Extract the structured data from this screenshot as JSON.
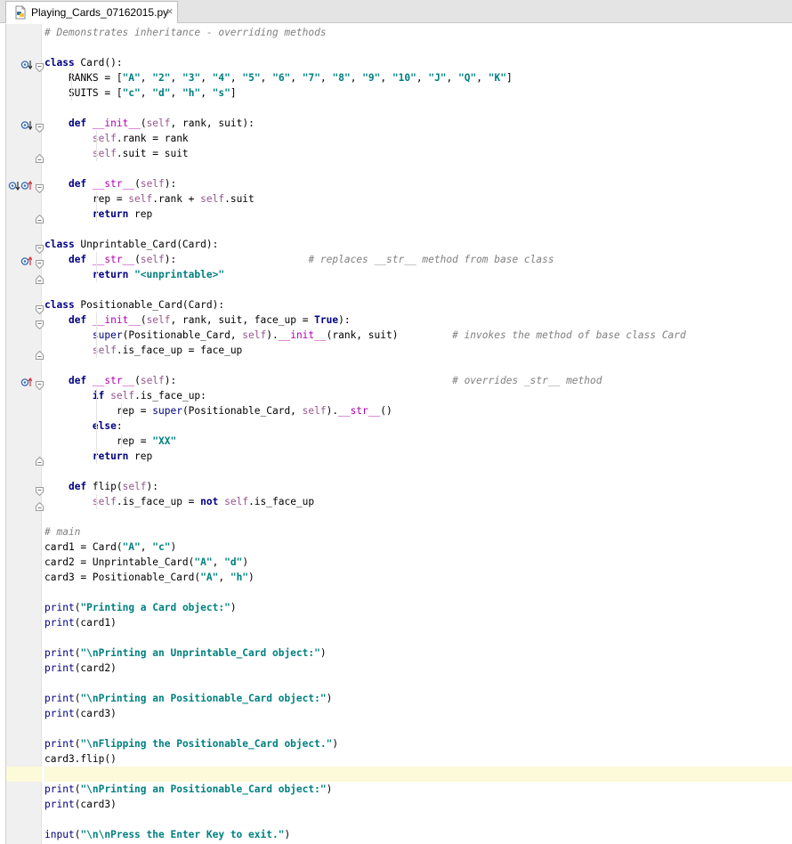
{
  "tab": {
    "title": "Playing_Cards_07162015.py",
    "close": "×"
  },
  "code_lines": [
    "# Demonstrates inheritance - overriding methods",
    "",
    "class Card():",
    "    RANKS = [\"A\", \"2\", \"3\", \"4\", \"5\", \"6\", \"7\", \"8\", \"9\", \"10\", \"J\", \"Q\", \"K\"]",
    "    SUITS = [\"c\", \"d\", \"h\", \"s\"]",
    "",
    "    def __init__(self, rank, suit):",
    "        self.rank = rank",
    "        self.suit = suit",
    "",
    "    def __str__(self):",
    "        rep = self.rank + self.suit",
    "        return rep",
    "",
    "class Unprintable_Card(Card):",
    "    def __str__(self):                      # replaces __str__ method from base class",
    "        return \"<unprintable>\"",
    "",
    "class Positionable_Card(Card):",
    "    def __init__(self, rank, suit, face_up = True):",
    "        super(Positionable_Card, self).__init__(rank, suit)         # invokes the method of base class Card",
    "        self.is_face_up = face_up",
    "",
    "    def __str__(self):                                              # overrides _str__ method",
    "        if self.is_face_up:",
    "            rep = super(Positionable_Card, self).__str__()",
    "        else:",
    "            rep = \"XX\"",
    "        return rep",
    "",
    "    def flip(self):",
    "        self.is_face_up = not self.is_face_up",
    "",
    "# main",
    "card1 = Card(\"A\", \"c\")",
    "card2 = Unprintable_Card(\"A\", \"d\")",
    "card3 = Positionable_Card(\"A\", \"h\")",
    "",
    "print(\"Printing a Card object:\")",
    "print(card1)",
    "",
    "print(\"\\nPrinting an Unprintable_Card object:\")",
    "print(card2)",
    "",
    "print(\"\\nPrinting an Positionable_Card object:\")",
    "print(card3)",
    "",
    "print(\"\\nFlipping the Positionable_Card object.\")",
    "card3.flip()",
    "",
    "print(\"\\nPrinting an Positionable_Card object:\")",
    "print(card3)",
    "",
    "input(\"\\n\\nPress the Enter Key to exit.\")"
  ],
  "current_line_index": 49,
  "colors": {
    "keyword": "#000080",
    "string": "#008080",
    "comment": "#808080",
    "self": "#94558d",
    "dunder": "#b200b2",
    "current_line": "#fcfad8"
  },
  "gutter_icons": [
    {
      "line": 2,
      "icons": [
        "overridden-down-icon"
      ]
    },
    {
      "line": 6,
      "icons": [
        "overridden-down-icon"
      ]
    },
    {
      "line": 10,
      "icons": [
        "overridden-down-icon",
        "overrides-up-icon"
      ]
    },
    {
      "line": 15,
      "icons": [
        "overrides-up-icon"
      ]
    },
    {
      "line": 23,
      "icons": [
        "overrides-up-icon"
      ]
    }
  ],
  "fold_markers": {
    "open": [
      2,
      6,
      10,
      14,
      15,
      18,
      19,
      23,
      30
    ],
    "close": [
      8,
      12,
      16,
      21,
      28,
      31
    ]
  }
}
